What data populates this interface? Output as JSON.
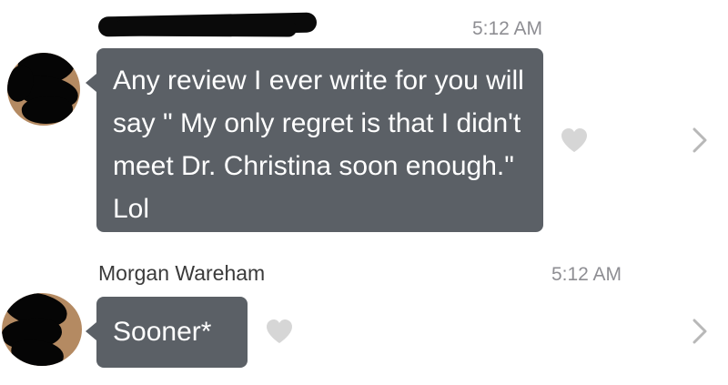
{
  "conversation": {
    "messages": [
      {
        "sender": "",
        "time": "5:12 AM",
        "text": "Any review I ever write for you will say \" My only regret is that I didn't meet Dr. Christina soon enough.\" Lol",
        "icons": {
          "like": "heart-icon",
          "more": "chevron-right-icon"
        }
      },
      {
        "sender": "Morgan Wareham",
        "time": "5:12 AM",
        "text": "Sooner*",
        "icons": {
          "like": "heart-icon",
          "more": "chevron-right-icon"
        }
      }
    ]
  },
  "colors": {
    "bubble": "#5b6066",
    "bubble_text": "#ffffff",
    "timestamp": "#8e8e93",
    "heart": "#d6d6d6",
    "chevron": "#b8b8b8",
    "redaction": "#0a0a0a"
  }
}
